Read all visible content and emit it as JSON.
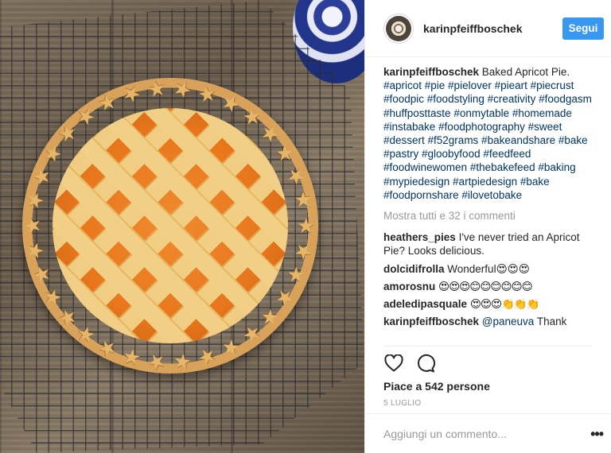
{
  "post": {
    "image_alt": "Baked Apricot Pie"
  },
  "header": {
    "username": "karinpfeiffboschek",
    "follow_label": "Segui"
  },
  "caption": {
    "username": "karinpfeiffboschek",
    "text": "Baked Apricot Pie.",
    "hashtags": "#apricot #pie #pielover #pieart #piecrust #foodpic #foodstyling #creativity #foodgasm #huffposttaste #onmytable #homemade #instabake #foodphotography #sweet #dessert #f52grams #bakeandshare #bake #pastry #gloobyfood #feedfeed #foodwinewomen #thebakefeed #baking #mypiedesign #artpiedesign #bake #foodpornshare #ilovetobake"
  },
  "show_all_comments": "Mostra tutti e 32 i commenti",
  "comments": [
    {
      "user": "heathers_pies",
      "text": "I've never tried an Apricot Pie? Looks delicious."
    },
    {
      "user": "dolcidifrolla",
      "text": "Wonderful😍😍😍"
    },
    {
      "user": "amorosnu",
      "text": "😍😍😍😊😊😊😊😊😊"
    },
    {
      "user": "adeledipasquale",
      "text": "😍😍😍👏👏👏"
    },
    {
      "user": "karinpfeiffboschek",
      "mention": "@paneuva",
      "text": "Thank"
    }
  ],
  "actions": {
    "like_icon": "heart-icon",
    "comment_icon": "speech-bubble-icon"
  },
  "likes_text": "Piace a 542 persone",
  "date_text": "5 LUGLIO",
  "add_comment_placeholder": "Aggiungi un commento...",
  "more_icon": "more-dots-icon",
  "colors": {
    "follow_button": "#3897f0",
    "hashtag": "#003569",
    "muted": "#999999"
  }
}
